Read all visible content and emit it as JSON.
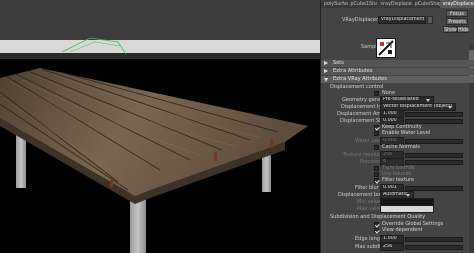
{
  "editor": {
    "tabs": [
      "polySurface3",
      "pCube1Shape1",
      "vrayDisplacement",
      "pCubeShape1",
      "vrayDisplacement"
    ],
    "active_tab_index": 4,
    "name_label": "VRayDisplacement:",
    "name_value": "vrayDisplacement",
    "focus_label": "Focus",
    "presets_label": "Presets",
    "show_label": "Show",
    "hide_label": "Hide",
    "sample_label": "Sample",
    "sections": {
      "sets": "Sets",
      "extra_attributes": "Extra Attributes",
      "extra_vray": "Extra VRay Attributes"
    },
    "displacement_header": "Displacement control",
    "none_label": "None",
    "geometry_generation_label": "Geometry generation",
    "geometry_generation_value": "Pre-tessellated",
    "displacement_type_label": "Displacement type",
    "displacement_type_value": "Vector displacement (object)",
    "displacement_amount_label": "Displacement Amount",
    "displacement_amount_value": "1.000",
    "displacement_shift_label": "Displacement Shift",
    "displacement_shift_value": "0.000",
    "keep_continuity_label": "Keep Continuity",
    "enable_water_level_label": "Enable Water Level",
    "water_level_label": "Water Level",
    "water_level_value": "0.000",
    "cache_normals_label": "Cache Normals",
    "texture_resolution_label": "Texture resolution",
    "texture_resolution_value": "256",
    "precision_label": "Precision",
    "precision_value": "8",
    "tight_bounds_label": "Tight bounds",
    "use_bounds_label": "Use bounds",
    "filter_texture_label": "Filter texture",
    "filter_blur_label": "Filter blur",
    "filter_blur_value": "0.001",
    "displacement_bounds_label": "Displacement bounds",
    "displacement_bounds_value": "Automatic",
    "min_value_label": "Min value",
    "max_value_label": "Max value",
    "subdivision_header": "Subdivision and Displacement Quality",
    "override_global_label": "Override Global Settings",
    "view_dependent_label": "View dependent",
    "edge_length_label": "Edge length",
    "edge_length_value": "1.000",
    "max_subdivs_label": "Max subdivs",
    "max_subdivs_value": "256"
  },
  "colors": {
    "editor_bg": "#444444",
    "viewport_bg": "#000000",
    "wood": "#6e5a45",
    "legs": "#b8b8b8"
  }
}
